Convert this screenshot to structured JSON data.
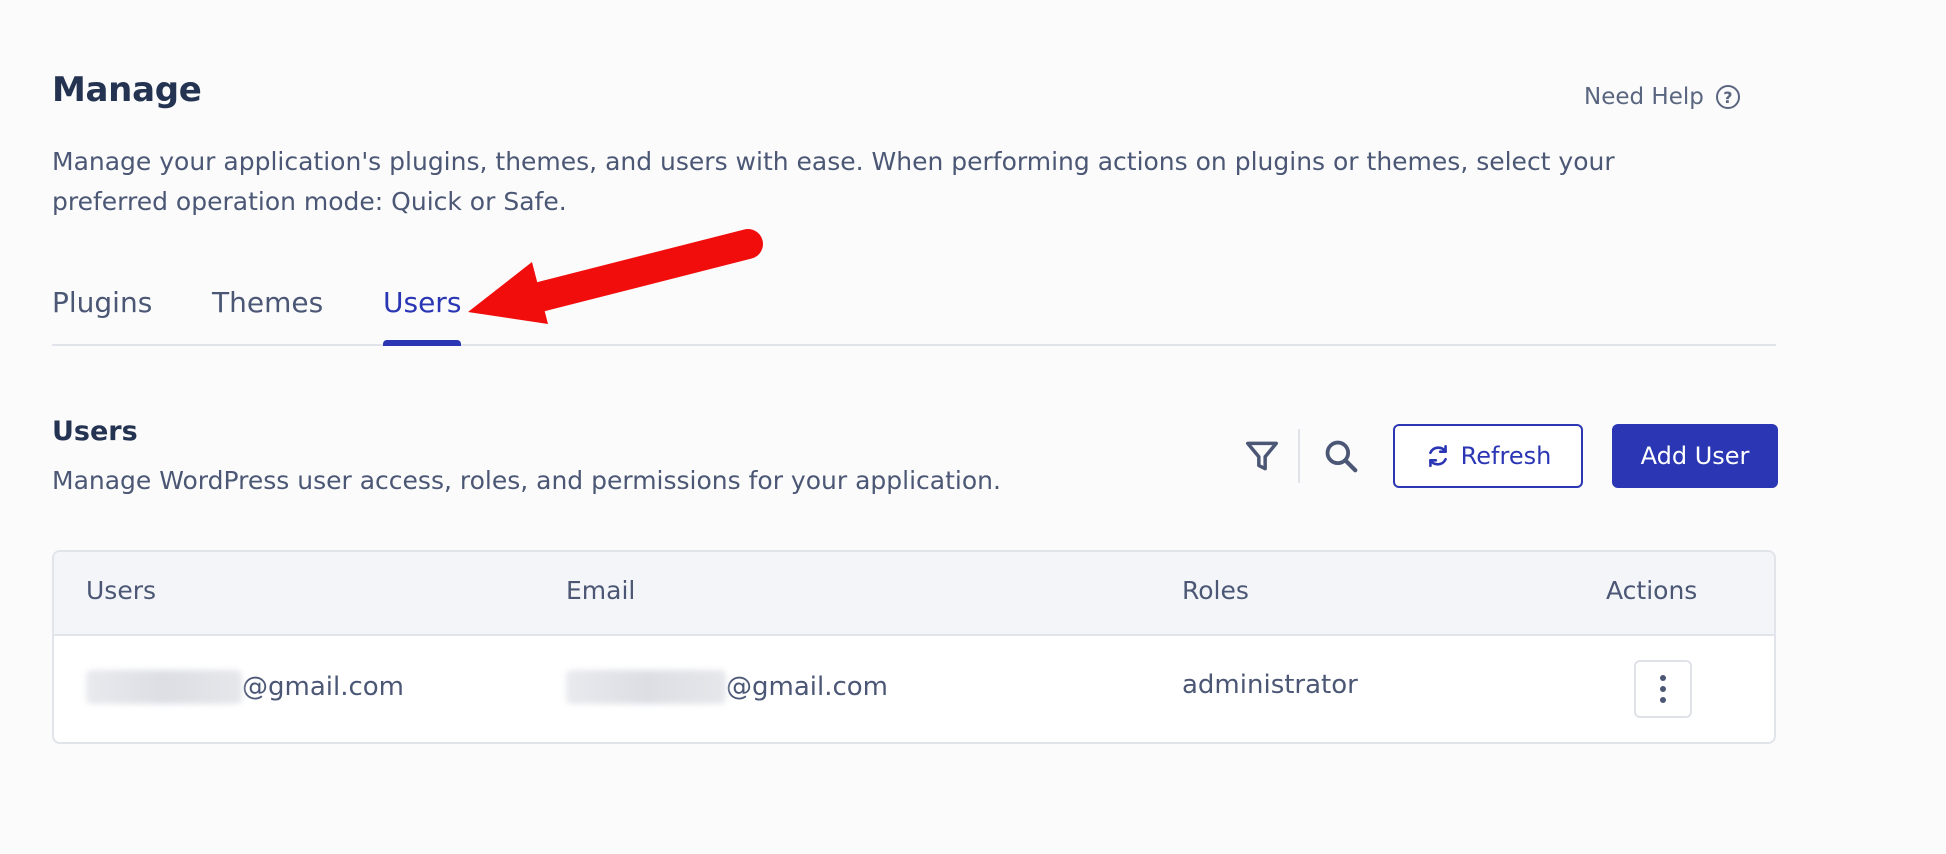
{
  "header": {
    "title": "Manage",
    "help_label": "Need Help",
    "help_icon": "question-circle-icon",
    "description": "Manage your application's plugins, themes, and users with ease. When performing actions on plugins or themes, select your preferred operation mode: Quick or Safe."
  },
  "tabs": [
    {
      "label": "Plugins",
      "active": false
    },
    {
      "label": "Themes",
      "active": false
    },
    {
      "label": "Users",
      "active": true
    }
  ],
  "section": {
    "title": "Users",
    "description": "Manage WordPress user access, roles, and permissions for your application."
  },
  "toolbar": {
    "filter_icon": "filter-icon",
    "search_icon": "search-icon",
    "refresh_label": "Refresh",
    "refresh_icon": "refresh-icon",
    "add_user_label": "Add User"
  },
  "table": {
    "columns": [
      "Users",
      "Email",
      "Roles",
      "Actions"
    ],
    "rows": [
      {
        "user": "@gmail.com",
        "email": "@gmail.com",
        "role": "administrator"
      }
    ]
  },
  "colors": {
    "accent": "#2b36b4",
    "annotation_arrow": "#f20d0d",
    "text_primary": "#243352",
    "text_secondary": "#4b5775"
  }
}
